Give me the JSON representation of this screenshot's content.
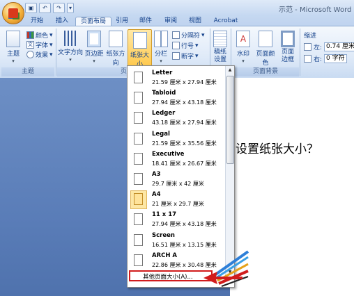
{
  "window": {
    "title": "示范 - Microsoft Word",
    "quick_access": [
      "save",
      "undo",
      "redo",
      "more"
    ]
  },
  "tabs": [
    {
      "label": "开始",
      "active": false
    },
    {
      "label": "插入",
      "active": false
    },
    {
      "label": "页面布局",
      "active": true
    },
    {
      "label": "引用",
      "active": false
    },
    {
      "label": "邮件",
      "active": false
    },
    {
      "label": "审阅",
      "active": false
    },
    {
      "label": "视图",
      "active": false
    },
    {
      "label": "Acrobat",
      "active": false
    }
  ],
  "ribbon": {
    "theme_group": {
      "label": "主题",
      "theme_button": "主题",
      "colors": "颜色",
      "fonts": "字体",
      "effects": "效果"
    },
    "page_setup_group": {
      "label": "页面设置",
      "text_direction": "文字方向",
      "margins": "页边距",
      "orientation": "纸张方向",
      "size": "纸张大小",
      "columns": "分栏",
      "breaks": "分隔符",
      "line_numbers": "行号",
      "hyphenation": "断字"
    },
    "draft_button": "稿纸设置",
    "background_group": {
      "label": "页面背景",
      "watermark": "水印",
      "page_color": "页面颜色",
      "page_borders": "页面边框"
    },
    "paragraph": {
      "indent_label": "缩进",
      "left_label": "左:",
      "left_value": "0.74 厘米",
      "right_label": "右:",
      "right_value": "0 字符"
    }
  },
  "dropdown": {
    "items": [
      {
        "name": "Letter",
        "dims": "21.59 厘米 x 27.94 厘米",
        "selected": false
      },
      {
        "name": "Tabloid",
        "dims": "27.94 厘米 x 43.18 厘米",
        "selected": false
      },
      {
        "name": "Ledger",
        "dims": "43.18 厘米 x 27.94 厘米",
        "selected": false
      },
      {
        "name": "Legal",
        "dims": "21.59 厘米 x 35.56 厘米",
        "selected": false
      },
      {
        "name": "Executive",
        "dims": "18.41 厘米 x 26.67 厘米",
        "selected": false
      },
      {
        "name": "A3",
        "dims": "29.7 厘米 x 42 厘米",
        "selected": false
      },
      {
        "name": "A4",
        "dims": "21 厘米 x 29.7 厘米",
        "selected": true
      },
      {
        "name": "11 x 17",
        "dims": "27.94 厘米 x 43.18 厘米",
        "selected": false
      },
      {
        "name": "Screen",
        "dims": "16.51 厘米 x 13.15 厘米",
        "selected": false
      },
      {
        "name": "ARCH A",
        "dims": "22.86 厘米 x 30.48 厘米",
        "selected": false
      }
    ],
    "more_sizes": "其他页面大小(A)..."
  },
  "document": {
    "text": "设置纸张大小？"
  },
  "colors": {
    "accent": "#15428b",
    "highlight": "#ffc94d",
    "annotation_red": "#d11c1c"
  }
}
